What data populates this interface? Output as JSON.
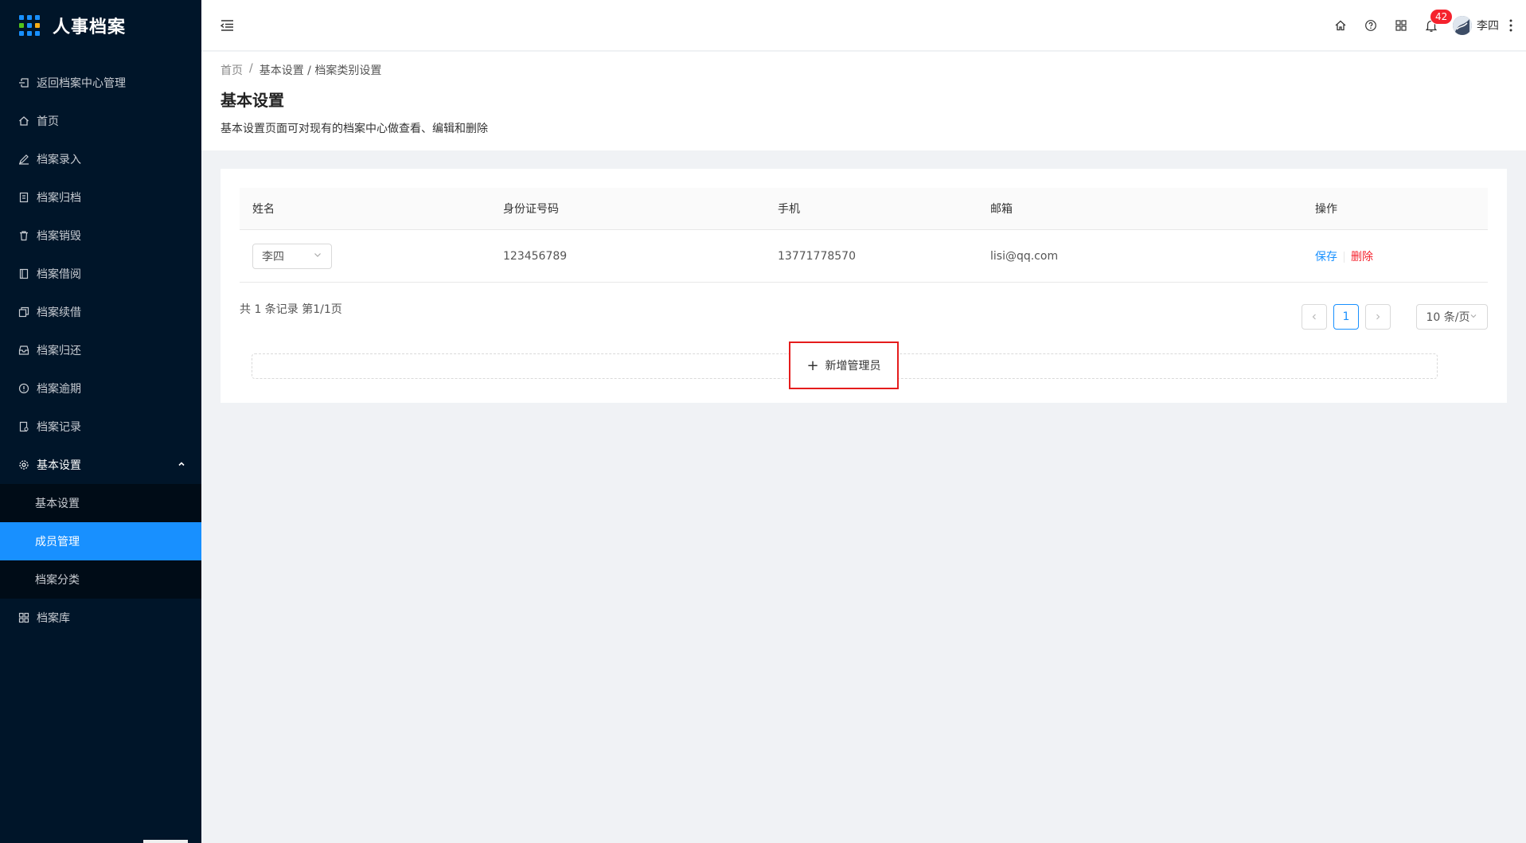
{
  "app": {
    "title": "人事档案",
    "logo_colors": [
      "#1890ff",
      "#1890ff",
      "#1890ff",
      "#52c41a",
      "#1890ff",
      "#faad14",
      "#1890ff",
      "#1890ff",
      "#1890ff"
    ]
  },
  "sidebar": {
    "items": [
      {
        "label": "返回档案中心管理",
        "icon": "back-icon"
      },
      {
        "label": "首页",
        "icon": "home-icon"
      },
      {
        "label": "档案录入",
        "icon": "edit-icon"
      },
      {
        "label": "档案归档",
        "icon": "archive-icon"
      },
      {
        "label": "档案销毁",
        "icon": "trash-icon"
      },
      {
        "label": "档案借阅",
        "icon": "book-icon"
      },
      {
        "label": "档案续借",
        "icon": "copy-icon"
      },
      {
        "label": "档案归还",
        "icon": "inbox-icon"
      },
      {
        "label": "档案逾期",
        "icon": "alert-icon"
      },
      {
        "label": "档案记录",
        "icon": "record-icon"
      },
      {
        "label": "基本设置",
        "icon": "gear-icon"
      }
    ],
    "submenu": [
      {
        "label": "基本设置"
      },
      {
        "label": "成员管理"
      },
      {
        "label": "档案分类"
      }
    ],
    "last_item": {
      "label": "档案库",
      "icon": "grid-icon"
    }
  },
  "header": {
    "notification_count": "42",
    "user_name": "李四"
  },
  "page": {
    "breadcrumb": [
      "首页",
      "基本设置 / 档案类别设置"
    ],
    "title": "基本设置",
    "description": "基本设置页面可对现有的档案中心做查看、编辑和删除"
  },
  "table": {
    "columns": [
      "姓名",
      "身份证号码",
      "手机",
      "邮箱",
      "操作"
    ],
    "rows": [
      {
        "name": "李四",
        "id_number": "123456789",
        "phone": "13771778570",
        "email": "lisi@qq.com",
        "save": "保存",
        "delete": "删除"
      }
    ]
  },
  "pagination": {
    "summary": "共 1 条记录 第1/1页",
    "current_page": "1",
    "page_size": "10 条/页"
  },
  "add_button": {
    "label": "新增管理员"
  }
}
